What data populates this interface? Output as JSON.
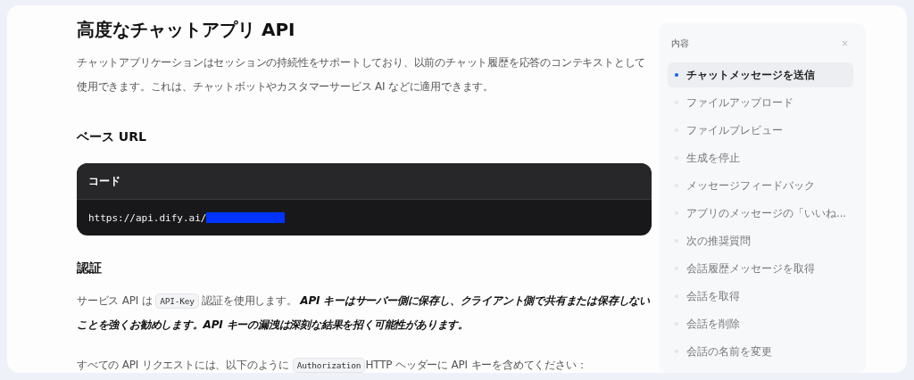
{
  "article": {
    "title": "高度なチャットアプリ API",
    "intro": "チャットアプリケーションはセッションの持続性をサポートしており、以前のチャット履歴を応答のコンテキストとして使用できます。これは、チャットボットやカスタマーサービス AI などに適用できます。",
    "base_url_heading": "ベース URL",
    "code_block": {
      "label": "コード",
      "code": "https://api.dify.ai/",
      "redacted": true
    },
    "auth_heading": "認証",
    "auth_paragraph": [
      {
        "kind": "text",
        "text": "サービス API は "
      },
      {
        "kind": "code",
        "text": "API-Key"
      },
      {
        "kind": "text",
        "text": " 認証を使用します。 "
      },
      {
        "kind": "emphasis",
        "text": "API キーはサーバー側に保存し、クライアント側で共有または保存しないことを強くお勧めします。API キーの漏洩は深刻な結果を招く可能性があります。"
      }
    ],
    "header_paragraph": [
      {
        "kind": "text",
        "text": "すべての API リクエストには、以下のように "
      },
      {
        "kind": "code",
        "text": "Authorization"
      },
      {
        "kind": "text",
        "text": "HTTP ヘッダーに API キーを含めてください："
      }
    ]
  },
  "toc": {
    "title": "内容",
    "close": "×",
    "items": [
      {
        "label": "チャットメッセージを送信",
        "selected": true
      },
      {
        "label": "ファイルアップロード",
        "selected": false
      },
      {
        "label": "ファイルプレビュー",
        "selected": false
      },
      {
        "label": "生成を停止",
        "selected": false
      },
      {
        "label": "メッセージフィードバック",
        "selected": false
      },
      {
        "label": "アプリのメッセージの「いいね...",
        "selected": false
      },
      {
        "label": "次の推奨質問",
        "selected": false
      },
      {
        "label": "会話履歴メッセージを取得",
        "selected": false
      },
      {
        "label": "会話を取得",
        "selected": false
      },
      {
        "label": "会話を削除",
        "selected": false
      },
      {
        "label": "会話の名前を変更",
        "selected": false
      }
    ]
  }
}
